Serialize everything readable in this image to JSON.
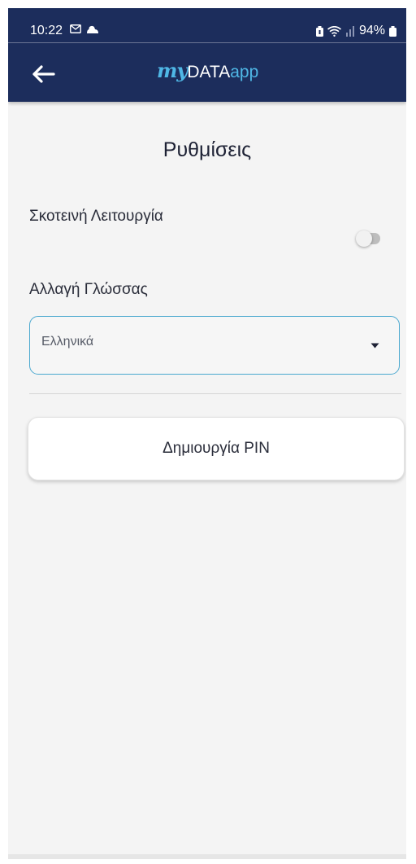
{
  "status_bar": {
    "time": "10:22",
    "battery": "94%",
    "icons": [
      "mail-icon",
      "cloud-icon",
      "battery-saver-icon",
      "wifi-icon",
      "signal-icon",
      "battery-icon"
    ]
  },
  "app_bar": {
    "back_icon": "arrow-left-icon",
    "logo": {
      "my": "my",
      "data": "DATA",
      "app": "app"
    },
    "colors": {
      "background": "#1c2d5c",
      "accent": "#4fb7e6"
    }
  },
  "settings": {
    "title": "Ρυθμίσεις",
    "dark_mode": {
      "label": "Σκοτεινή Λειτουργία",
      "enabled": false
    },
    "language": {
      "label": "Αλλαγή Γλώσσας",
      "selected": "Ελληνικά",
      "caret_icon": "caret-down-icon"
    },
    "create_pin_label": "Δημιουργία PIN"
  }
}
